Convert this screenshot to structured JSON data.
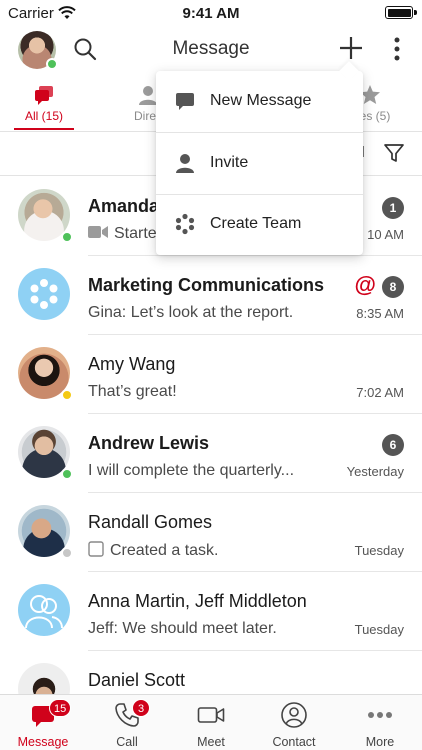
{
  "status_bar": {
    "carrier": "Carrier",
    "time": "9:41 AM"
  },
  "header": {
    "title": "Message"
  },
  "tabs": [
    {
      "label": "All (15)",
      "icon": "chat-bubbles-icon",
      "active": true
    },
    {
      "label": "Direc",
      "icon": "person-icon",
      "active": false
    },
    {
      "label": "rites (5)",
      "icon": "star-icon",
      "active": false
    }
  ],
  "filter_bar": {
    "partial_label": "ll"
  },
  "dropdown_menu": {
    "items": [
      {
        "label": "New Message",
        "icon": "message-icon"
      },
      {
        "label": "Invite",
        "icon": "person-icon"
      },
      {
        "label": "Create Team",
        "icon": "team-dots-icon"
      }
    ]
  },
  "conversations": [
    {
      "name": "Amanda",
      "preview": "Starte",
      "time": "10 AM",
      "badge": "1",
      "bold": true,
      "presence": "green",
      "preview_icon": "video-icon"
    },
    {
      "name": "Marketing Communications",
      "preview": "Gina: Let’s look at the report.",
      "time": "8:35 AM",
      "badge": "8",
      "mention": "@",
      "bold": true
    },
    {
      "name": "Amy Wang",
      "preview": "That’s great!",
      "time": "7:02 AM",
      "bold": false,
      "presence": "yellow"
    },
    {
      "name": "Andrew Lewis",
      "preview": "I will complete the quarterly...",
      "time": "Yesterday",
      "badge": "6",
      "bold": true,
      "presence": "green"
    },
    {
      "name": "Randall Gomes",
      "preview": "Created a task.",
      "time": "Tuesday",
      "bold": false,
      "presence": "gray",
      "preview_icon": "checkbox-icon"
    },
    {
      "name": "Anna Martin, Jeff Middleton",
      "preview": "Jeff: We should meet later.",
      "time": "Tuesday",
      "bold": false
    },
    {
      "name": "Daniel Scott",
      "preview": "",
      "time": "",
      "bold": false
    }
  ],
  "tab_bar": [
    {
      "label": "Message",
      "icon": "message-bubble-icon",
      "badge": "15",
      "active": true
    },
    {
      "label": "Call",
      "icon": "phone-icon",
      "badge": "3",
      "active": false
    },
    {
      "label": "Meet",
      "icon": "video-camera-icon",
      "active": false
    },
    {
      "label": "Contact",
      "icon": "contact-icon",
      "active": false
    },
    {
      "label": "More",
      "icon": "more-dots-icon",
      "active": false
    }
  ],
  "colors": {
    "accent": "#d0021b",
    "badge_gray": "#555555",
    "presence_green": "#4fc15a",
    "presence_yellow": "#f4c913"
  }
}
